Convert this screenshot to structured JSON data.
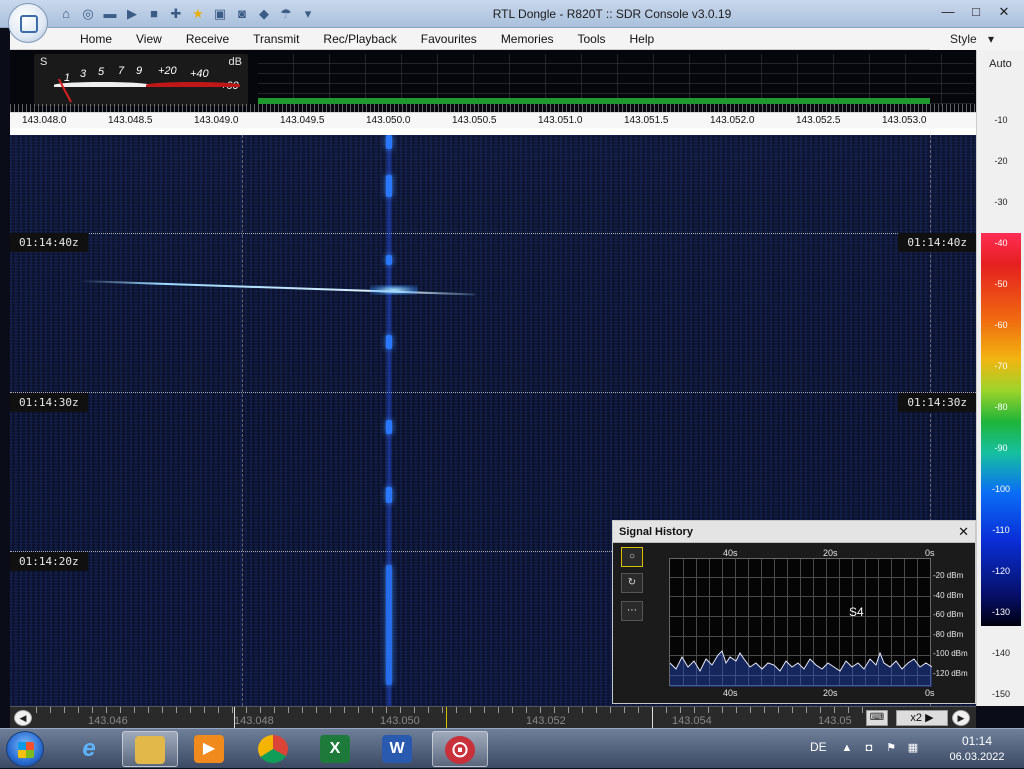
{
  "window": {
    "title": "RTL Dongle - R820T :: SDR Console v3.0.19",
    "minimize_glyph": "—",
    "maximize_glyph": "□",
    "close_glyph": "✕"
  },
  "quick_access": {
    "icons": [
      "home-icon",
      "lifebuoy-icon",
      "folder-icon",
      "play-icon",
      "stop-icon",
      "plus-icon",
      "star-icon",
      "lock-icon",
      "camera-icon",
      "drop-icon",
      "antenna-icon",
      "dropdown-icon"
    ]
  },
  "menu": {
    "items": [
      "Home",
      "View",
      "Receive",
      "Transmit",
      "Rec/Playback",
      "Favourites",
      "Memories",
      "Tools",
      "Help"
    ],
    "style_label": "Style"
  },
  "smeter": {
    "s_label": "S",
    "db_label": "dB",
    "scale_white": [
      "1",
      "3",
      "5",
      "7",
      "9"
    ],
    "scale_red": [
      "+20",
      "+40",
      "+60"
    ]
  },
  "freq_axis": {
    "ticks": [
      "143.048.0",
      "143.048.5",
      "143.049.0",
      "143.049.5",
      "143.050.0",
      "143.050.5",
      "143.051.0",
      "143.051.5",
      "143.052.0",
      "143.052.5",
      "143.053.0"
    ]
  },
  "waterfall": {
    "time_labels": [
      "01:14:40z",
      "01:14:30z",
      "01:14:20z"
    ]
  },
  "db_scale": {
    "auto_label": "Auto",
    "ticks": [
      "-10",
      "-20",
      "-30",
      "-40",
      "-50",
      "-60",
      "-70",
      "-80",
      "-90",
      "-100",
      "-110",
      "-120",
      "-130",
      "-140",
      "-150"
    ]
  },
  "signal_history": {
    "title": "Signal History",
    "close_glyph": "✕",
    "x_top": [
      "40s",
      "20s",
      "0s"
    ],
    "x_bottom": [
      "40s",
      "20s",
      "0s"
    ],
    "y_labels": [
      "-20 dBm",
      "-40 dBm",
      "-60 dBm",
      "-80 dBm",
      "-100 dBm",
      "-120 dBm"
    ],
    "s_reading": "S4",
    "tools": [
      "record-icon",
      "refresh-icon",
      "more-icon"
    ],
    "tool_glyphs": [
      "○",
      "↻",
      "⋯"
    ]
  },
  "tuner": {
    "labels": [
      "143.046",
      "143.048",
      "143.050",
      "143.052",
      "143.054",
      "143.05"
    ],
    "keyboard_glyph": "⌨",
    "zoom_label": "x2 ▶",
    "left_glyph": "◀",
    "right_glyph": "▶"
  },
  "taskbar": {
    "apps": [
      {
        "name": "ie",
        "glyph": "e",
        "color": "#1e7ad6"
      },
      {
        "name": "explorer",
        "glyph": "■",
        "color": "#e2b84a"
      },
      {
        "name": "media",
        "glyph": "▶",
        "color": "#f08a1c"
      },
      {
        "name": "chrome",
        "glyph": "●",
        "color": "#2da84a"
      },
      {
        "name": "excel",
        "glyph": "X",
        "color": "#1d7a3a"
      },
      {
        "name": "word",
        "glyph": "W",
        "color": "#2a5ab0"
      },
      {
        "name": "sdr-console",
        "glyph": "⨀",
        "color": "#c8303a"
      }
    ],
    "lang": "DE",
    "time": "01:14",
    "date": "06.03.2022"
  }
}
